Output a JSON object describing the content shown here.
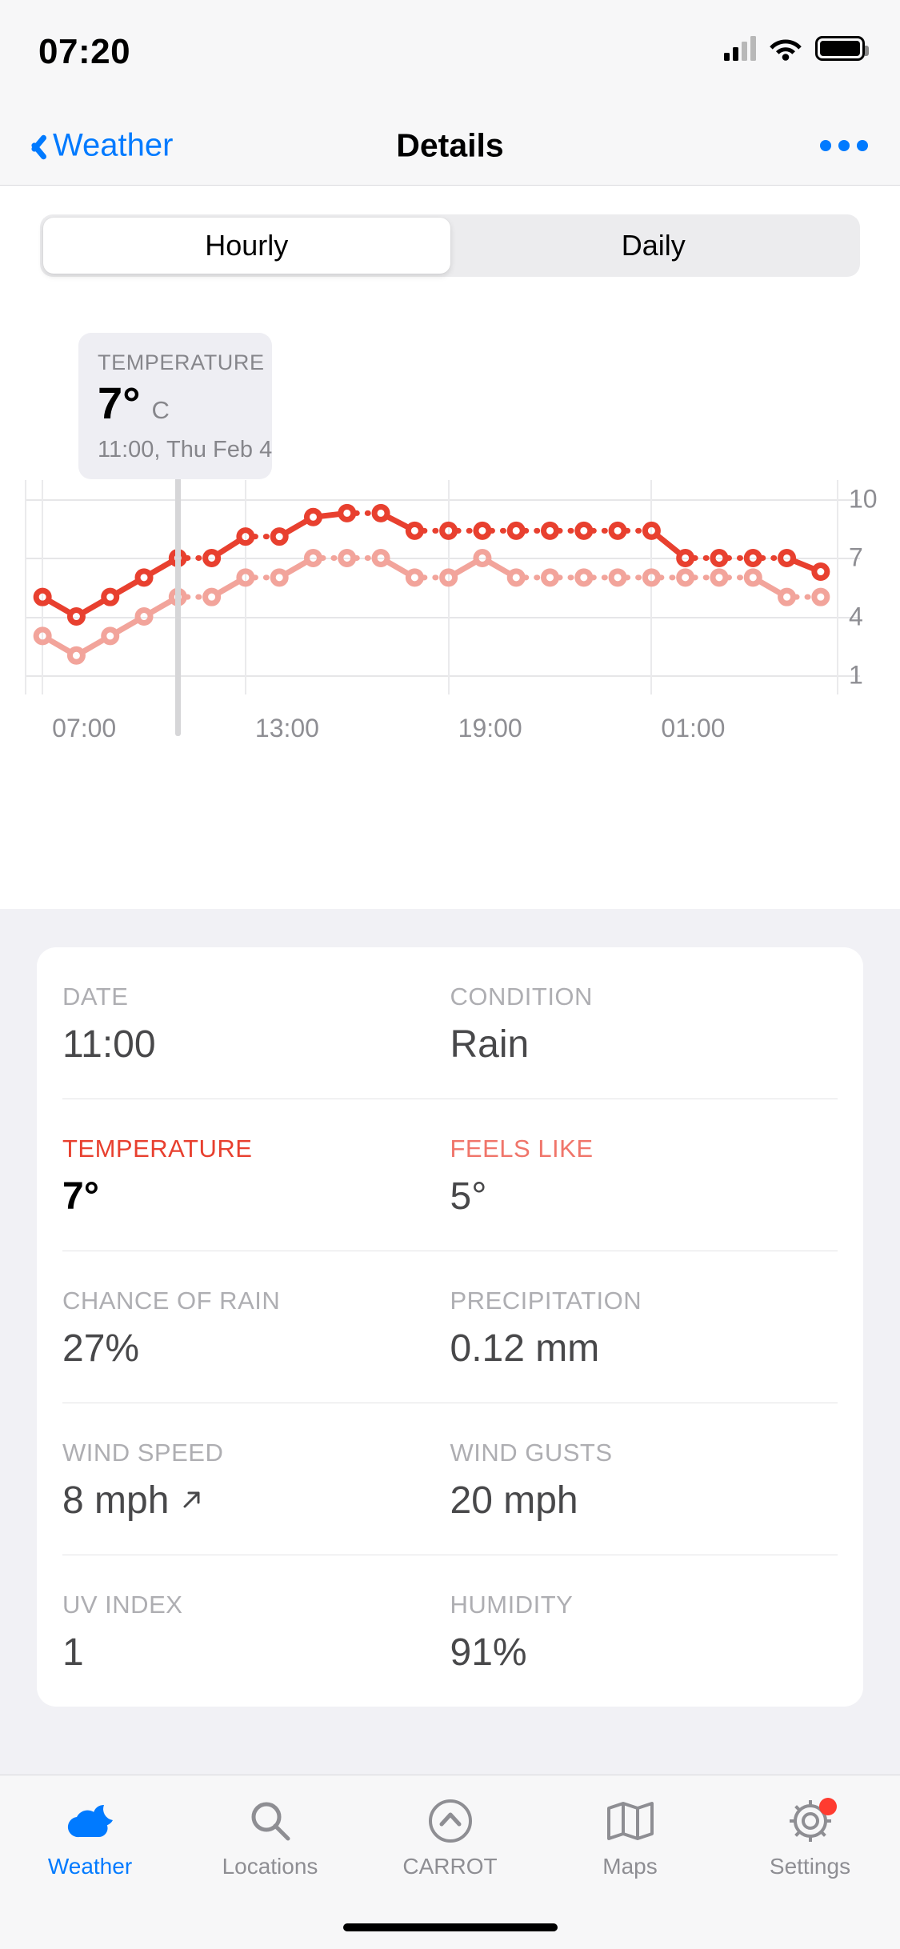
{
  "status_bar": {
    "time": "07:20",
    "signal_icon": "cellular-signal-icon",
    "wifi_icon": "wifi-icon",
    "battery_icon": "battery-icon"
  },
  "nav": {
    "back_label": "Weather",
    "back_icon": "chevron-left-icon",
    "title": "Details",
    "more_icon": "more-ellipsis-icon"
  },
  "segmented": {
    "options": [
      "Hourly",
      "Daily"
    ],
    "selected": "Hourly"
  },
  "tooltip": {
    "label": "TEMPERATURE",
    "value": "7°",
    "unit": "C",
    "time": "11:00, Thu Feb 4"
  },
  "chart_data": {
    "type": "line",
    "title": "",
    "xlabel": "",
    "ylabel": "",
    "ylim": [
      0,
      11
    ],
    "yticks": [
      10,
      7,
      4,
      1
    ],
    "ytick_labels": [
      "10",
      "7",
      "4",
      "1"
    ],
    "xtick_labels": [
      "07:00",
      "13:00",
      "19:00",
      "01:00"
    ],
    "xtick_indices": [
      0,
      6,
      12,
      18
    ],
    "grid": true,
    "legend": "none",
    "cursor_index": 4,
    "cursor_label": "11:00, Thu Feb 4",
    "x": [
      "07:00",
      "08:00",
      "09:00",
      "10:00",
      "11:00",
      "12:00",
      "13:00",
      "14:00",
      "15:00",
      "16:00",
      "17:00",
      "18:00",
      "19:00",
      "20:00",
      "21:00",
      "22:00",
      "23:00",
      "00:00",
      "01:00",
      "02:00",
      "03:00",
      "04:00",
      "05:00",
      "06:00"
    ],
    "series": [
      {
        "name": "Temperature",
        "color": "#e8402f",
        "values": [
          5.0,
          4.0,
          5.0,
          6.0,
          7.0,
          7.0,
          8.1,
          8.1,
          9.1,
          9.3,
          9.3,
          8.4,
          8.4,
          8.4,
          8.4,
          8.4,
          8.4,
          8.4,
          8.4,
          7.0,
          7.0,
          7.0,
          7.0,
          6.3
        ]
      },
      {
        "name": "Feels like",
        "color": "#f2a49b",
        "values": [
          3.0,
          2.0,
          3.0,
          4.0,
          5.0,
          5.0,
          6.0,
          6.0,
          7.0,
          7.0,
          7.0,
          6.0,
          6.0,
          7.0,
          6.0,
          6.0,
          6.0,
          6.0,
          6.0,
          6.0,
          6.0,
          6.0,
          5.0,
          5.0
        ]
      }
    ]
  },
  "details": {
    "rows": [
      [
        {
          "key": "DATE",
          "value": "11:00",
          "emphasis": "none"
        },
        {
          "key": "CONDITION",
          "value": "Rain",
          "emphasis": "none"
        }
      ],
      [
        {
          "key": "TEMPERATURE",
          "value": "7°",
          "emphasis": "hot"
        },
        {
          "key": "FEELS LIKE",
          "value": "5°",
          "emphasis": "warm"
        }
      ],
      [
        {
          "key": "CHANCE OF RAIN",
          "value": "27%",
          "emphasis": "none"
        },
        {
          "key": "PRECIPITATION",
          "value": "0.12 mm",
          "emphasis": "none"
        }
      ],
      [
        {
          "key": "WIND SPEED",
          "value": "8 mph",
          "emphasis": "none",
          "icon": "arrow-north-east-icon"
        },
        {
          "key": "WIND GUSTS",
          "value": "20 mph",
          "emphasis": "none"
        }
      ],
      [
        {
          "key": "UV INDEX",
          "value": "1",
          "emphasis": "none"
        },
        {
          "key": "HUMIDITY",
          "value": "91%",
          "emphasis": "none"
        }
      ]
    ]
  },
  "tabbar": {
    "items": [
      {
        "label": "Weather",
        "icon": "cloud-moon-icon",
        "active": true,
        "badge": false
      },
      {
        "label": "Locations",
        "icon": "search-icon",
        "active": false,
        "badge": false
      },
      {
        "label": "CARROT",
        "icon": "carrot-icon",
        "active": false,
        "badge": false
      },
      {
        "label": "Maps",
        "icon": "map-icon",
        "active": false,
        "badge": false
      },
      {
        "label": "Settings",
        "icon": "gear-icon",
        "active": false,
        "badge": true
      }
    ]
  },
  "colors": {
    "accent": "#007aff",
    "temperature": "#e8402f",
    "feels_like": "#f2a49b",
    "badge": "#ff3b30"
  }
}
